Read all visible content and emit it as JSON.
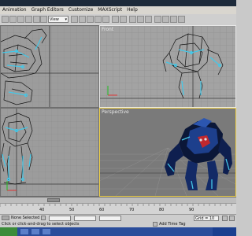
{
  "menu": {
    "items": [
      "Animation",
      "Graph Editors",
      "Customize",
      "MAXScript",
      "Help"
    ]
  },
  "toolbar": {
    "view_select": "View"
  },
  "viewports": {
    "front_label": "Front",
    "perspective_label": "Perspective"
  },
  "status": {
    "selection_text": "None Selected",
    "prompt_text": "Click or click-and-drag to select objects",
    "add_time_tag": "Add Time Tag",
    "grid_label": "Grid = 10"
  },
  "timeline": {
    "tick_labels": [
      "40",
      "50",
      "60",
      "70",
      "80",
      "90"
    ]
  },
  "colors": {
    "wire": "#44c8e8",
    "model_dark": "#0b1738",
    "model_blue": "#1d3f8c",
    "accent_red": "#c0282e"
  }
}
